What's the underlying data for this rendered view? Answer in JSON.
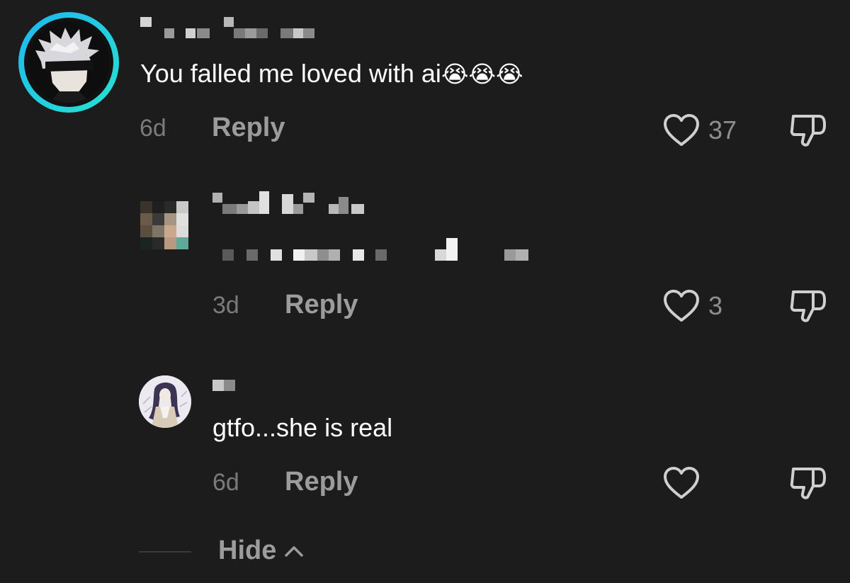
{
  "comments": [
    {
      "text": "You falled me loved with ai",
      "emoji": "😭😭😭",
      "time": "6d",
      "reply_label": "Reply",
      "likes": "37"
    },
    {
      "text": "",
      "time": "3d",
      "reply_label": "Reply",
      "likes": "3"
    },
    {
      "text": "gtfo...she is real",
      "time": "6d",
      "reply_label": "Reply",
      "likes": ""
    }
  ],
  "footer": {
    "hide_label": "Hide"
  },
  "icons": {
    "like": "heart-outline-icon",
    "dislike": "thumbs-down-outline-icon",
    "collapse": "chevron-up-icon"
  },
  "colors": {
    "background": "#1c1c1c",
    "avatar_ring_start": "#1fb6f0",
    "avatar_ring_end": "#27e3d0",
    "meta_text": "#7b7b7b",
    "reply_text": "#9c9c9c"
  }
}
